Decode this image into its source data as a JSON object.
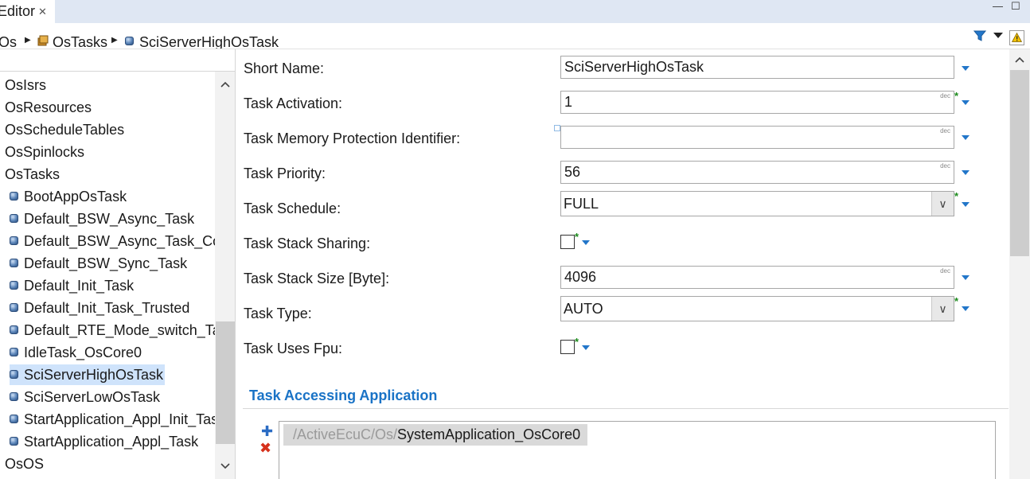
{
  "tab": {
    "label": "Editor",
    "close": "✕"
  },
  "window_controls": {
    "minimize": "—",
    "maximize": "☐"
  },
  "breadcrumb": {
    "items": [
      "Os",
      "OsTasks",
      "SciServerHighOsTask"
    ],
    "sep": "▶"
  },
  "tree": {
    "items": [
      {
        "label": "OsIsrs",
        "kind": "root"
      },
      {
        "label": "OsResources",
        "kind": "root"
      },
      {
        "label": "OsScheduleTables",
        "kind": "root"
      },
      {
        "label": "OsSpinlocks",
        "kind": "root"
      },
      {
        "label": "OsTasks",
        "kind": "root"
      },
      {
        "label": "BootAppOsTask",
        "kind": "child"
      },
      {
        "label": "Default_BSW_Async_Task",
        "kind": "child"
      },
      {
        "label": "Default_BSW_Async_Task_Core",
        "kind": "child"
      },
      {
        "label": "Default_BSW_Sync_Task",
        "kind": "child"
      },
      {
        "label": "Default_Init_Task",
        "kind": "child"
      },
      {
        "label": "Default_Init_Task_Trusted",
        "kind": "child"
      },
      {
        "label": "Default_RTE_Mode_switch_Task",
        "kind": "child"
      },
      {
        "label": "IdleTask_OsCore0",
        "kind": "child"
      },
      {
        "label": "SciServerHighOsTask",
        "kind": "child",
        "selected": true
      },
      {
        "label": "SciServerLowOsTask",
        "kind": "child"
      },
      {
        "label": "StartApplication_Appl_Init_Task",
        "kind": "child"
      },
      {
        "label": "StartApplication_Appl_Task",
        "kind": "child"
      },
      {
        "label": "OsOS",
        "kind": "root"
      }
    ]
  },
  "form": {
    "short_name": {
      "label": "Short Name:",
      "value": "SciServerHighOsTask"
    },
    "task_activation": {
      "label": "Task Activation:",
      "value": "1",
      "unit": "dec"
    },
    "task_mem_prot": {
      "label": "Task Memory Protection Identifier:",
      "value": "",
      "unit": "dec"
    },
    "task_priority": {
      "label": "Task Priority:",
      "value": "56",
      "unit": "dec"
    },
    "task_schedule": {
      "label": "Task Schedule:",
      "value": "FULL"
    },
    "task_stack_sharing": {
      "label": "Task Stack Sharing:",
      "checked": false
    },
    "task_stack_size": {
      "label": "Task Stack Size [Byte]:",
      "value": "4096",
      "unit": "dec"
    },
    "task_type": {
      "label": "Task Type:",
      "value": "AUTO"
    },
    "task_uses_fpu": {
      "label": "Task Uses Fpu:",
      "checked": false
    },
    "star": "*",
    "chevron": "∨"
  },
  "section": {
    "title": "Task Accessing Application",
    "ref_prefix": "/ActiveEcuC/Os/",
    "ref_name": "SystemApplication_OsCore0",
    "add_glyph": "✚",
    "remove_glyph": "✖"
  },
  "colors": {
    "accent": "#1a73c6",
    "selection": "#cfe3fb",
    "required_star": "#1b8a1b"
  }
}
